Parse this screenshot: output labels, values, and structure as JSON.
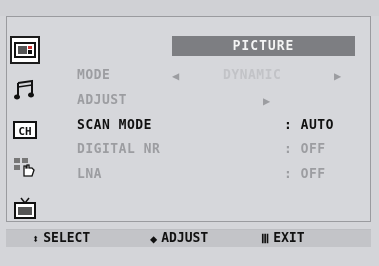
{
  "menu": {
    "title": "PICTURE",
    "rows": [
      {
        "label": "MODE",
        "value": "DYNAMIC",
        "state": "dim"
      },
      {
        "label": "ADJUST",
        "value": "",
        "state": "dim"
      },
      {
        "label": "SCAN MODE",
        "value": ": AUTO",
        "state": "highlight"
      },
      {
        "label": "DIGITAL NR",
        "value": ": OFF",
        "state": "dim"
      },
      {
        "label": "LNA",
        "value": ": OFF",
        "state": "dim"
      }
    ],
    "side_icons": [
      "picture-icon",
      "sound-icon",
      "channel-icon",
      "setup-icon",
      "input-icon"
    ],
    "active_icon": "picture-icon"
  },
  "footer": {
    "select": "SELECT",
    "adjust": "ADJUST",
    "exit": "EXIT"
  },
  "colors": {
    "background": "#d4d5d9",
    "title_bar": "#7d7e82",
    "dim_text": "#9c9da1",
    "highlight_text": "#111111"
  }
}
